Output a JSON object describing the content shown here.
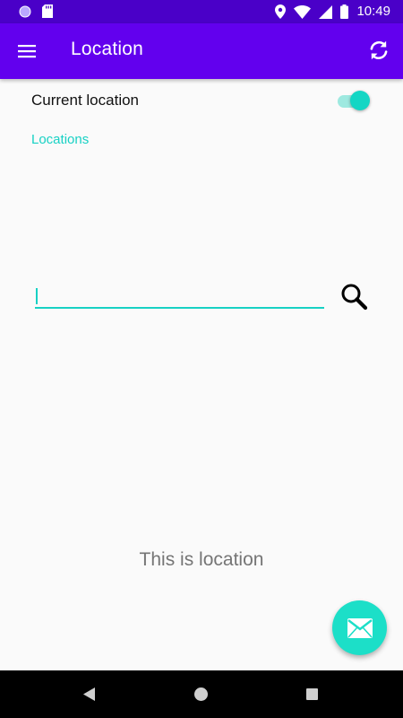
{
  "status_bar": {
    "time": "10:49",
    "icons": [
      "circle-notification-icon",
      "sd-card-icon",
      "location-pin-icon",
      "wifi-icon",
      "signal-icon",
      "battery-icon"
    ]
  },
  "app_bar": {
    "title": "Location",
    "menu_icon": "hamburger-menu-icon",
    "action_icon": "refresh-icon",
    "color": "#6200ee"
  },
  "settings": {
    "current_location_label": "Current location",
    "current_location_enabled": true,
    "locations_label": "Locations"
  },
  "search": {
    "value": "",
    "placeholder": "",
    "button_icon": "search-icon"
  },
  "main": {
    "body_text": "This is location"
  },
  "fab": {
    "icon": "email-icon",
    "color": "#1cdfc8"
  },
  "nav_bar": {
    "icons": [
      "back-icon",
      "home-icon",
      "recents-icon"
    ]
  },
  "accent_color": "#17d1c4"
}
